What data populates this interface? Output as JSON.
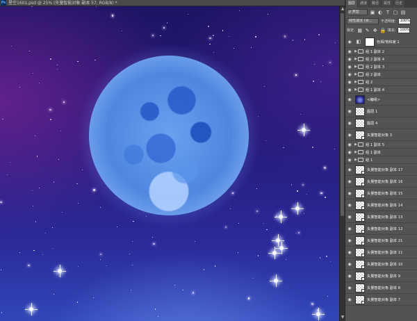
{
  "document": {
    "app_badge": "Ps",
    "title": "星空1601.psd @ 25% (矢量智能对象 副本 57, RGB/8) *"
  },
  "panel": {
    "tabs": [
      "图层",
      "通道",
      "路径",
      "属性",
      "历史"
    ],
    "active_tab": "图层",
    "filter_type": "ρ 类型",
    "blend_mode": "线性减淡 (添…",
    "opacity_label": "不透明度:",
    "opacity_value": "100%",
    "lock_label": "锁定:",
    "fill_label": "填充:",
    "fill_value": "100%"
  },
  "layers": [
    {
      "name": "色相/饱和度 1",
      "kind": "adjustment"
    },
    {
      "name": "组 1 副本 2",
      "kind": "group"
    },
    {
      "name": "组 2 副本 4",
      "kind": "group"
    },
    {
      "name": "组 2 副本 3",
      "kind": "group"
    },
    {
      "name": "组 2 副本",
      "kind": "group"
    },
    {
      "name": "组 2",
      "kind": "group"
    },
    {
      "name": "组 1 副本 4",
      "kind": "group"
    },
    {
      "name": "<编组>",
      "kind": "image"
    },
    {
      "name": "图层 1",
      "kind": "raster"
    },
    {
      "name": "图层 4",
      "kind": "raster"
    },
    {
      "name": "矢量智能对象 3",
      "kind": "smart"
    },
    {
      "name": "组 1 副本 5",
      "kind": "group"
    },
    {
      "name": "组 1 副本",
      "kind": "group"
    },
    {
      "name": "组 1",
      "kind": "group"
    },
    {
      "name": "矢量智能对象 副本 17",
      "kind": "smart"
    },
    {
      "name": "矢量智能对象 副本 16",
      "kind": "smart"
    },
    {
      "name": "矢量智能对象 副本 15",
      "kind": "smart"
    },
    {
      "name": "矢量智能对象 副本 14",
      "kind": "smart"
    },
    {
      "name": "矢量智能对象 副本 13",
      "kind": "smart"
    },
    {
      "name": "矢量智能对象 副本 12",
      "kind": "smart"
    },
    {
      "name": "矢量智能对象 副本 21",
      "kind": "smart"
    },
    {
      "name": "矢量智能对象 副本 11",
      "kind": "smart"
    },
    {
      "name": "矢量智能对象 副本 10",
      "kind": "smart"
    },
    {
      "name": "矢量智能对象 副本 9",
      "kind": "smart"
    },
    {
      "name": "矢量智能对象 副本 8",
      "kind": "smart"
    },
    {
      "name": "矢量智能对象 副本 7",
      "kind": "smart"
    }
  ],
  "colors": {
    "sky_top": "#1d1465",
    "sky_bottom": "#3147b8",
    "moon": "#6aa2f0",
    "panel_bg": "#535353"
  }
}
